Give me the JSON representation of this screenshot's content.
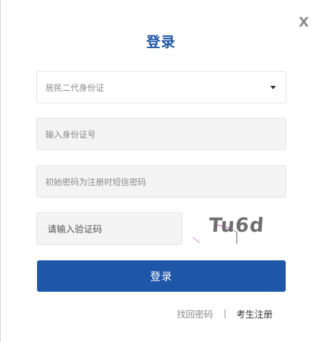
{
  "dialog": {
    "title": "登录",
    "close_label": "X"
  },
  "form": {
    "id_type": {
      "selected": "居民二代身份证"
    },
    "id_number": {
      "placeholder": "输入身份证号"
    },
    "password": {
      "placeholder": "初始密码为注册时短信密码"
    },
    "captcha": {
      "placeholder": "请输入验证码",
      "image_text": "Tu6d"
    },
    "submit_label": "登录"
  },
  "links": {
    "forgot_password": "找回密码",
    "separator": "|",
    "register": "考生注册"
  },
  "colors": {
    "accent": "#1f57a8",
    "title": "#1e55a4"
  }
}
